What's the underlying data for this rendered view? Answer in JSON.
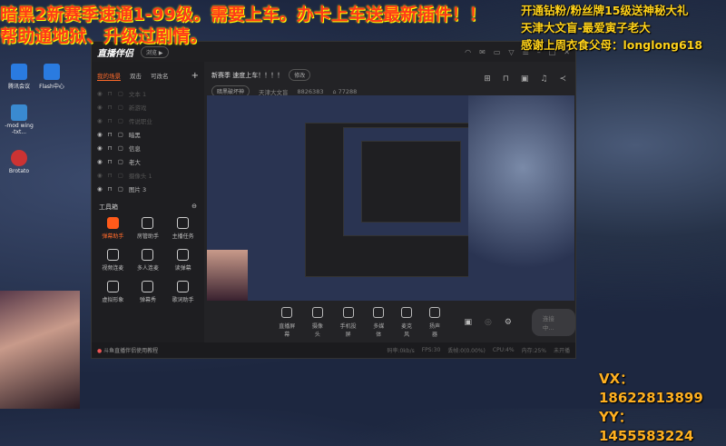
{
  "overlay": {
    "banner_line1": "暗黑2新赛季速通1-99级。需要上车。办卡上车送最新插件！！",
    "banner_line2": "帮助通地狱、升级过剧情。",
    "right_lines": [
      "开通钻粉/粉丝牌15级送神秘大礼",
      "天津大文盲-最爱寅子老大",
      "感谢上周衣食父母：longlong618"
    ],
    "vx": "VX：18622813899",
    "yy": "YY：1455583224"
  },
  "desktop": [
    "腾讯会议",
    "Flash中心",
    "-mod wing -txt...",
    "Brotato"
  ],
  "app": {
    "name": "直播伴侣",
    "pill": "浏览 ▶",
    "tabs": [
      "我的场景",
      "双击",
      "可改名"
    ],
    "add": "+",
    "sources": [
      {
        "label": "文本 1",
        "on": false
      },
      {
        "label": "新游戏",
        "on": false
      },
      {
        "label": "传说职业",
        "on": false
      },
      {
        "label": "暗黑",
        "on": true
      },
      {
        "label": "信息",
        "on": true
      },
      {
        "label": "老大",
        "on": true
      },
      {
        "label": "摄像头 1",
        "on": false
      },
      {
        "label": "图片 3",
        "on": true
      }
    ],
    "toolbox_title": "工具箱",
    "tools": [
      "弹幕助手",
      "房管助手",
      "主播任务",
      "视频连麦",
      "多人连麦",
      "读弹幕",
      "虚拟形象",
      "弹幕秀",
      "歌词助手"
    ],
    "stream_title": "新赛季 速度上车！！！！",
    "edit": "修改",
    "category": "暗黑破坏神",
    "streamer": "天津大文盲",
    "room_id": "8826383",
    "heat": "77288",
    "bottom": [
      "直播屏幕",
      "摄像头",
      "手机投屏",
      "多媒体",
      "麦克风",
      "扬声器"
    ],
    "live_button": "连接中...",
    "tutorial": "斗鱼直播伴侣使用教程",
    "stats": [
      "码率:0kb/s",
      "FPS:30",
      "丢帧:0(0.00%)",
      "CPU:4%",
      "内存:25%",
      "未开播"
    ]
  }
}
